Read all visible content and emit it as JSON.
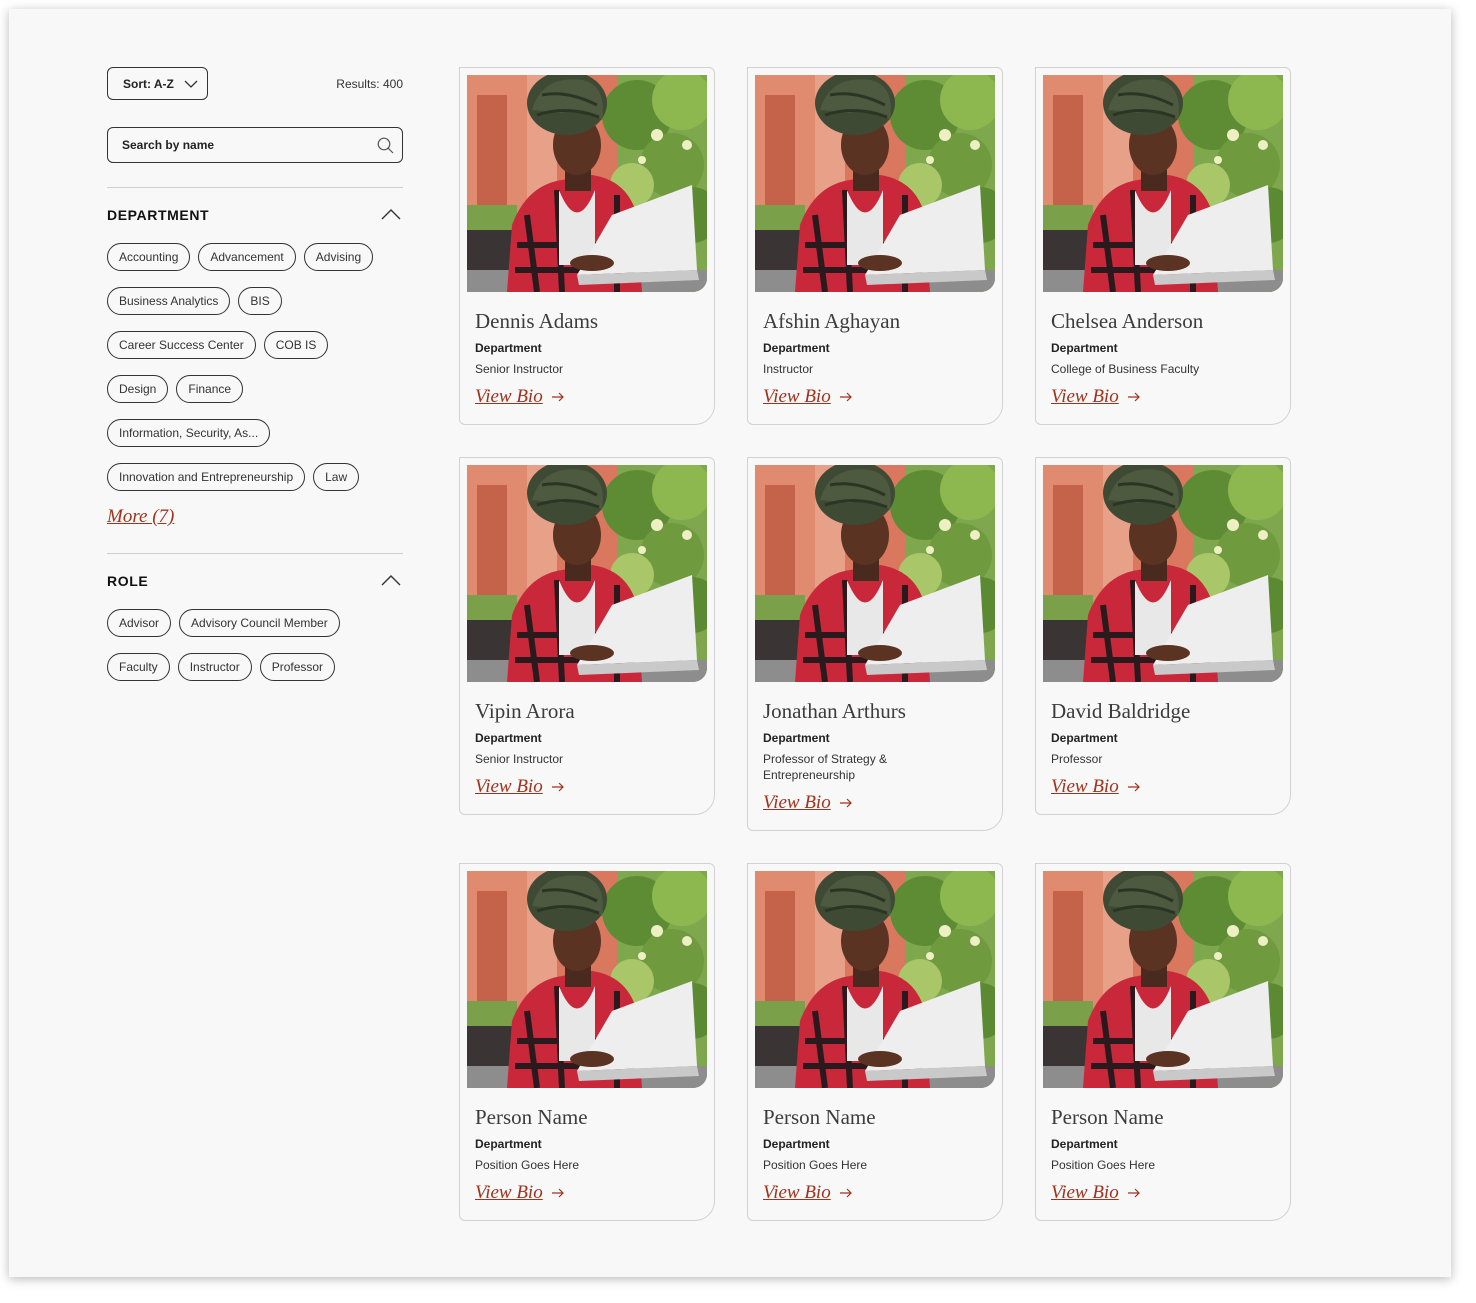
{
  "toolbar": {
    "sort_label": "Sort: A-Z",
    "results_label": "Results: 400"
  },
  "search": {
    "placeholder": "Search by name"
  },
  "filters": {
    "department": {
      "title": "DEPARTMENT",
      "chips": [
        "Accounting",
        "Advancement",
        "Advising",
        "Business Analytics",
        "BIS",
        "Career Success Center",
        "COB IS",
        "Design",
        "Finance",
        "Information, Security, As...",
        "Innovation and Entrepreneurship",
        "Law"
      ],
      "more_label": "More (7)"
    },
    "role": {
      "title": "ROLE",
      "chips": [
        "Advisor",
        "Advisory Council Member",
        "Faculty",
        "Instructor",
        "Professor"
      ]
    }
  },
  "colors": {
    "accent": "#a1321d",
    "background": "#f8f8f8",
    "border": "#333333"
  },
  "people": [
    {
      "name": "Dennis Adams",
      "dept_label": "Department",
      "position": "Senior Instructor",
      "link": "View Bio"
    },
    {
      "name": "Afshin Aghayan",
      "dept_label": "Department",
      "position": "Instructor",
      "link": "View Bio"
    },
    {
      "name": "Chelsea Anderson",
      "dept_label": "Department",
      "position": "College of Business Faculty",
      "link": "View Bio"
    },
    {
      "name": "Vipin Arora",
      "dept_label": "Department",
      "position": "Senior Instructor",
      "link": "View Bio"
    },
    {
      "name": "Jonathan Arthurs",
      "dept_label": "Department",
      "position": "Professor of Strategy & Entrepreneurship",
      "link": "View Bio"
    },
    {
      "name": "David Baldridge",
      "dept_label": "Department",
      "position": "Professor",
      "link": "View Bio"
    },
    {
      "name": "Person Name",
      "dept_label": "Department",
      "position": "Position Goes Here",
      "link": "View Bio"
    },
    {
      "name": "Person Name",
      "dept_label": "Department",
      "position": "Position Goes Here",
      "link": "View Bio"
    },
    {
      "name": "Person Name",
      "dept_label": "Department",
      "position": "Position Goes Here",
      "link": "View Bio"
    }
  ]
}
